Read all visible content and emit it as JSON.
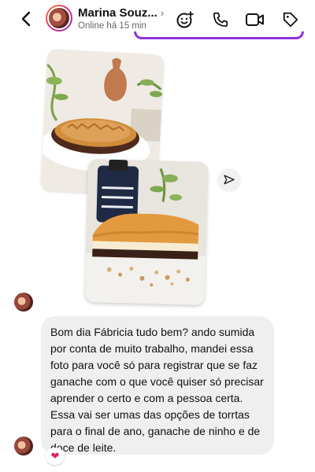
{
  "header": {
    "contact_name": "Marina Souz...",
    "status": "Online há 15 min",
    "chevron": "›"
  },
  "icons": {
    "back": "chevron-left-icon",
    "add_emoji": "emoji-add-icon",
    "call": "phone-icon",
    "video": "video-camera-icon",
    "tag": "tag-icon",
    "share": "send-icon"
  },
  "colors": {
    "accent": "#8e33e0",
    "bubble": "#efefef",
    "heart": "#e0245e"
  },
  "message": {
    "text": "Bom dia Fábricia tudo bem? ando sumida por conta de muito trabalho, mandei essa foto para você só para registrar que se faz ganache com o que você quiser só precisar aprender o certo e com a pessoa certa. Essa vai ser umas das opções de torrtas para o final de ano, ganache de ninho e de doce de leite.",
    "reaction": "❤"
  }
}
